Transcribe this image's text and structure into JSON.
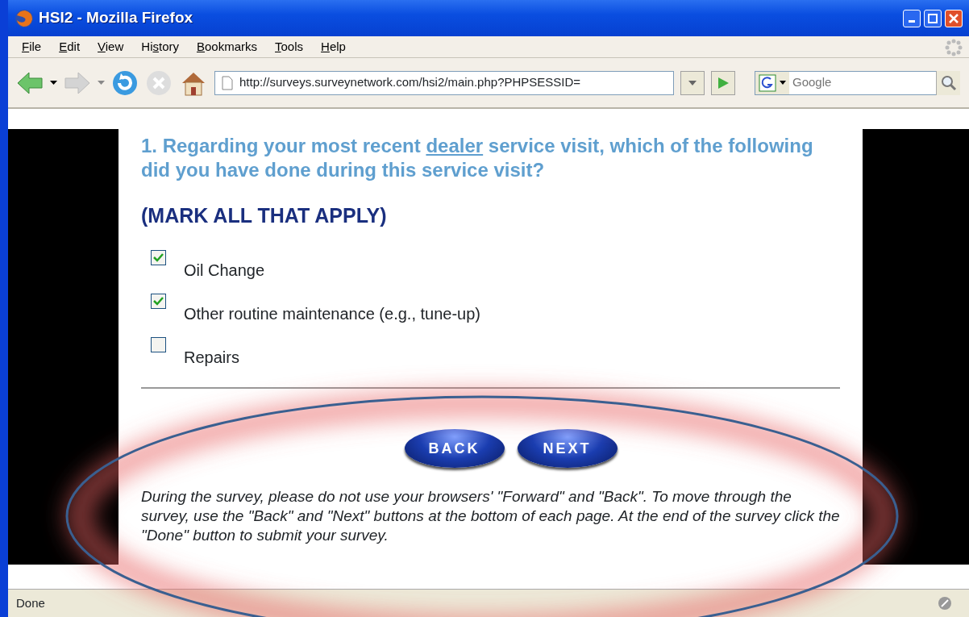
{
  "window": {
    "title": "HSI2 - Mozilla Firefox"
  },
  "menu": [
    {
      "key": "F",
      "after": "ile"
    },
    {
      "key": "E",
      "after": "dit"
    },
    {
      "key": "V",
      "after": "iew"
    },
    {
      "before": "Hi",
      "key": "s",
      "after": "tory"
    },
    {
      "key": "B",
      "after": "ookmarks"
    },
    {
      "key": "T",
      "after": "ools"
    },
    {
      "key": "H",
      "after": "elp"
    }
  ],
  "address_bar": {
    "url": "http://surveys.surveynetwork.com/hsi2/main.php?PHPSESSID="
  },
  "search": {
    "placeholder": "Google"
  },
  "question": {
    "before": "1. Regarding your most recent ",
    "underlined": "dealer",
    "after": " service visit, which of the following did you have done during this service visit?"
  },
  "instruction": "(MARK ALL THAT APPLY)",
  "options": [
    {
      "label": "Oil Change",
      "checked": true
    },
    {
      "label": "Other routine maintenance (e.g., tune-up)",
      "checked": true
    },
    {
      "label": "Repairs",
      "checked": false
    }
  ],
  "nav_buttons": [
    {
      "label": "BACK"
    },
    {
      "label": "NEXT"
    }
  ],
  "note": "During the survey, please do not use your browsers' \"Forward\" and \"Back\". To move through the survey, use the \"Back\" and \"Next\" buttons at the bottom of each page. At the end of the survey click the \"Done\" button to submit your survey.",
  "status_bar": {
    "text": "Done"
  }
}
